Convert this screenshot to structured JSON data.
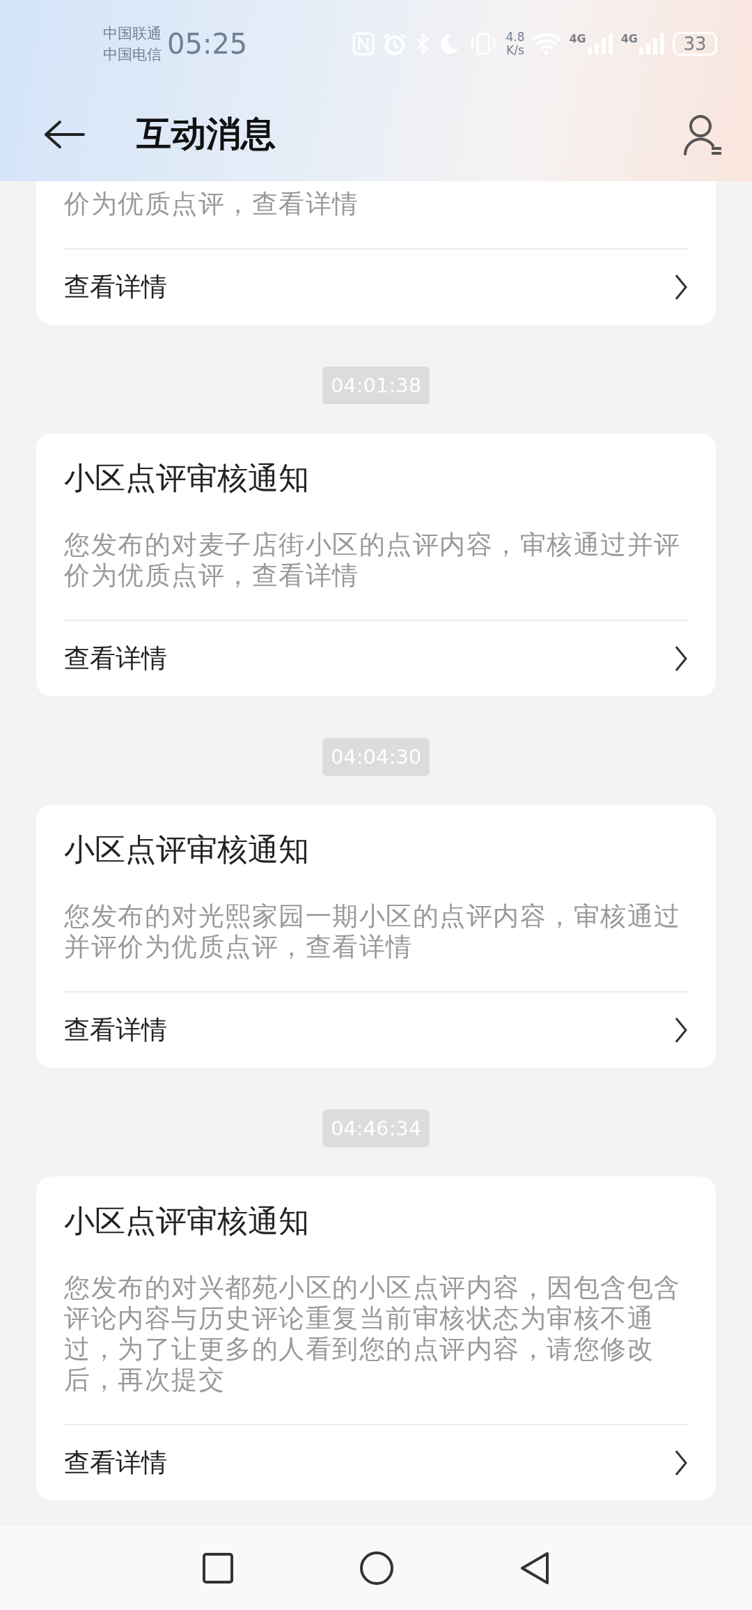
{
  "status_bar": {
    "carriers": [
      "中国联通",
      "中国电信"
    ],
    "time": "05:25",
    "net_speed": [
      "4.8",
      "K/s"
    ],
    "signals": [
      "4G",
      "4G"
    ],
    "battery": "33"
  },
  "header": {
    "title": "互动消息"
  },
  "messages": [
    {
      "body": "价为优质点评，查看详情",
      "link": "查看详情"
    },
    {
      "time": "04:01:38",
      "title": "小区点评审核通知",
      "body": "您发布的对麦子店街小区的点评内容，审核通过并评价为优质点评，查看详情",
      "link": "查看详情"
    },
    {
      "time": "04:04:30",
      "title": "小区点评审核通知",
      "body": "您发布的对光熙家园一期小区的点评内容，审核通过并评价为优质点评，查看详情",
      "link": "查看详情"
    },
    {
      "time": "04:46:34",
      "title": "小区点评审核通知",
      "body": "您发布的对兴都苑小区的小区点评内容，因包含包含评论内容与历史评论重复当前审核状态为审核不通过，为了让更多的人看到您的点评内容，请您修改后，再次提交",
      "link": "查看详情"
    }
  ]
}
